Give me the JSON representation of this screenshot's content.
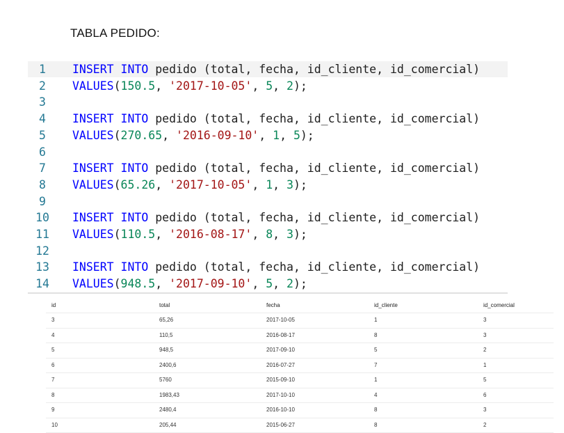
{
  "heading": "TABLA PEDIDO:",
  "code_lines": [
    {
      "n": "1",
      "parts": [
        [
          "kw",
          "INSERT INTO"
        ],
        [
          "",
          "pedido (total, fecha, id_cliente, id_comercial)"
        ]
      ]
    },
    {
      "n": "2",
      "parts": [
        [
          "kw",
          "VALUES"
        ],
        [
          "",
          "("
        ],
        [
          "num",
          "150.5"
        ],
        [
          "",
          ", "
        ],
        [
          "str",
          "'2017-10-05'"
        ],
        [
          "",
          ", "
        ],
        [
          "num",
          "5"
        ],
        [
          "",
          ", "
        ],
        [
          "num",
          "2"
        ],
        [
          "",
          ");"
        ]
      ]
    },
    {
      "n": "3",
      "parts": []
    },
    {
      "n": "4",
      "parts": [
        [
          "kw",
          "INSERT INTO"
        ],
        [
          "",
          "pedido (total, fecha, id_cliente, id_comercial)"
        ]
      ]
    },
    {
      "n": "5",
      "parts": [
        [
          "kw",
          "VALUES"
        ],
        [
          "",
          "("
        ],
        [
          "num",
          "270.65"
        ],
        [
          "",
          ", "
        ],
        [
          "str",
          "'2016-09-10'"
        ],
        [
          "",
          ", "
        ],
        [
          "num",
          "1"
        ],
        [
          "",
          ", "
        ],
        [
          "num",
          "5"
        ],
        [
          "",
          ");"
        ]
      ]
    },
    {
      "n": "6",
      "parts": []
    },
    {
      "n": "7",
      "parts": [
        [
          "kw",
          "INSERT INTO"
        ],
        [
          "",
          "pedido (total, fecha, id_cliente, id_comercial)"
        ]
      ]
    },
    {
      "n": "8",
      "parts": [
        [
          "kw",
          "VALUES"
        ],
        [
          "",
          "("
        ],
        [
          "num",
          "65.26"
        ],
        [
          "",
          ", "
        ],
        [
          "str",
          "'2017-10-05'"
        ],
        [
          "",
          ", "
        ],
        [
          "num",
          "1"
        ],
        [
          "",
          ", "
        ],
        [
          "num",
          "3"
        ],
        [
          "",
          ");"
        ]
      ]
    },
    {
      "n": "9",
      "parts": []
    },
    {
      "n": "10",
      "parts": [
        [
          "kw",
          "INSERT INTO"
        ],
        [
          "",
          "pedido (total, fecha, id_cliente, id_comercial)"
        ]
      ]
    },
    {
      "n": "11",
      "parts": [
        [
          "kw",
          "VALUES"
        ],
        [
          "",
          "("
        ],
        [
          "num",
          "110.5"
        ],
        [
          "",
          ", "
        ],
        [
          "str",
          "'2016-08-17'"
        ],
        [
          "",
          ", "
        ],
        [
          "num",
          "8"
        ],
        [
          "",
          ", "
        ],
        [
          "num",
          "3"
        ],
        [
          "",
          ");"
        ]
      ]
    },
    {
      "n": "12",
      "parts": []
    },
    {
      "n": "13",
      "parts": [
        [
          "kw",
          "INSERT INTO"
        ],
        [
          "",
          "pedido (total, fecha, id_cliente, id_comercial)"
        ]
      ]
    },
    {
      "n": "14",
      "parts": [
        [
          "kw",
          "VALUES"
        ],
        [
          "",
          "("
        ],
        [
          "num",
          "948.5"
        ],
        [
          "",
          ", "
        ],
        [
          "str",
          "'2017-09-10'"
        ],
        [
          "",
          ", "
        ],
        [
          "num",
          "5"
        ],
        [
          "",
          ", "
        ],
        [
          "num",
          "2"
        ],
        [
          "",
          ");"
        ]
      ]
    }
  ],
  "table": {
    "columns": [
      "id",
      "total",
      "fecha",
      "id_cliente",
      "id_comercial"
    ],
    "rows": [
      [
        "3",
        "65,26",
        "2017-10-05",
        "1",
        "3"
      ],
      [
        "4",
        "110,5",
        "2016-08-17",
        "8",
        "3"
      ],
      [
        "5",
        "948,5",
        "2017-09-10",
        "5",
        "2"
      ],
      [
        "6",
        "2400,6",
        "2016-07-27",
        "7",
        "1"
      ],
      [
        "7",
        "5760",
        "2015-09-10",
        "1",
        "5"
      ],
      [
        "8",
        "1983,43",
        "2017-10-10",
        "4",
        "6"
      ],
      [
        "9",
        "2480,4",
        "2016-10-10",
        "8",
        "3"
      ],
      [
        "10",
        "205,44",
        "2015-06-27",
        "8",
        "2"
      ]
    ]
  },
  "colors": {
    "keyword": "#0000ff",
    "number": "#098658",
    "string": "#a31515",
    "line_number": "#237893"
  }
}
